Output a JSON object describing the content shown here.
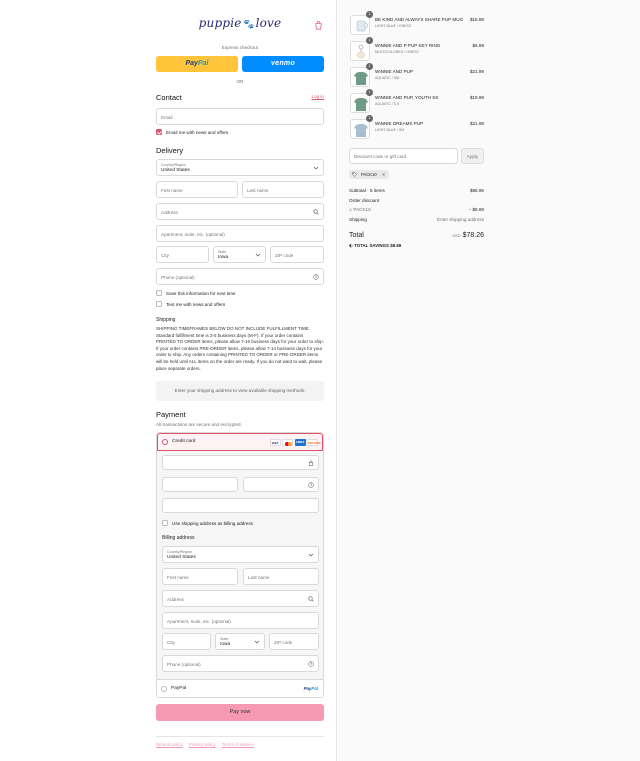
{
  "brand": {
    "logo_left": "puppie",
    "logo_right": "love",
    "logo_paw": "🐾"
  },
  "express": {
    "title": "Express checkout",
    "paypal_a": "Pay",
    "paypal_b": "Pal",
    "venmo": "venmo",
    "or": "OR"
  },
  "contact": {
    "title": "Contact",
    "login": "Log in",
    "email_placeholder": "Email",
    "newsletter_label": "Email me with news and offers",
    "newsletter_checked": true
  },
  "delivery": {
    "title": "Delivery",
    "country_label": "Country/Region",
    "country_value": "United States",
    "first_name": "First name",
    "last_name": "Last name",
    "address": "Address",
    "apartment": "Apartment, suite, etc. (optional)",
    "city": "City",
    "state_label": "State",
    "state_value": "Iowa",
    "zip": "ZIP code",
    "phone": "Phone (optional)",
    "save_info": "Save this information for next time",
    "text_me": "Text me with news and offers"
  },
  "shipping": {
    "title": "Shipping",
    "notice": "SHIPPING TIMEFRAMES BELOW DO NOT INCLUDE FULFILLMENT TIME. Standard fulfillment time is 3-5 business days (M-F). If your order contains PRINTED TO ORDER items, please allow 7-10 business days for your order to ship. If your order contains PRE-ORDER items, please allow 7-14 business days for your order to ship. Any orders containing PRINTED TO ORDER or PRE-ORDER items will be held until ALL items on the order are ready. If you do not want to wait, please place separate orders.",
    "placeholder": "Enter your shipping address to view available shipping methods."
  },
  "payment": {
    "title": "Payment",
    "subtitle": "All transactions are secure and encrypted.",
    "credit_card": "Credit card",
    "cards": [
      "VISA",
      "",
      "AMEX",
      "DISCOVER"
    ],
    "billing_same": "Use shipping address as billing address",
    "billing_title": "Billing address",
    "paypal": "PayPal",
    "pay_now": "Pay now"
  },
  "billing": {
    "country_label": "Country/Region",
    "country_value": "United States",
    "first_name": "First name",
    "last_name": "Last name",
    "address": "Address",
    "apartment": "Apartment, suite, etc. (optional)",
    "city": "City",
    "state_label": "State",
    "state_value": "Iowa",
    "zip": "ZIP code",
    "phone": "Phone (optional)"
  },
  "footer": {
    "links": [
      "Refund policy",
      "Privacy policy",
      "Terms of service"
    ]
  },
  "cart": {
    "items": [
      {
        "qty": "1",
        "name": "BE KIND AND ALWAYS SHARE PUP MUG",
        "variant": "LIGHT BLUE / ONESZ",
        "price": "$15.99",
        "thumb": "#dfe9ef"
      },
      {
        "qty": "1",
        "name": "WINNIE AND P PUP KEY RING",
        "variant": "MULTICOLORED / ONESZ",
        "price": "$6.99",
        "thumb": "#f4ecd8"
      },
      {
        "qty": "1",
        "name": "WINNIE AND PUP",
        "variant": "AQUATIC / SM",
        "price": "$21.99",
        "thumb": "#6f9a88"
      },
      {
        "qty": "1",
        "name": "WINNIE AND PUP, YOUTH SS",
        "variant": "AQUATIC / S 8",
        "price": "$19.99",
        "thumb": "#6f9a88"
      },
      {
        "qty": "1",
        "name": "WINNIE DREAMS PUP",
        "variant": "LIGHT BLUE / SM",
        "price": "$21.99",
        "thumb": "#a7bfd1"
      }
    ],
    "discount_placeholder": "Discount code or gift card",
    "apply": "Apply",
    "applied_code": "PACK10",
    "subtotal_label": "Subtotal · 5 items",
    "subtotal": "$86.95",
    "order_discount_label": "Order discount",
    "discount_code": "PACK10",
    "discount_amount": "− $8.69",
    "shipping_label": "Shipping",
    "shipping_value": "Enter shipping address",
    "total_label": "Total",
    "currency": "USD",
    "total": "$78.26",
    "savings_label": "TOTAL SAVINGS",
    "savings": "$8.69"
  },
  "colors": {
    "accent": "#e0516b",
    "pay_button": "#f59ab2",
    "paypal": "#ffc439",
    "venmo": "#008cff"
  }
}
